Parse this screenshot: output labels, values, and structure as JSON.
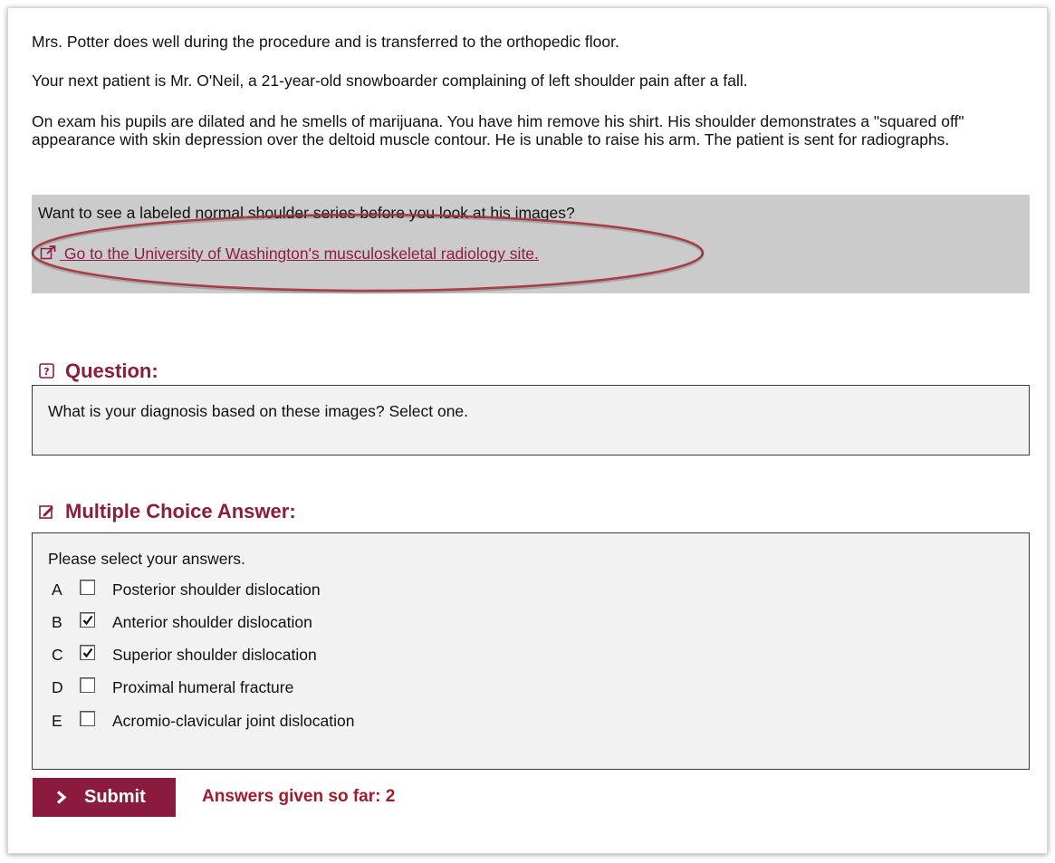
{
  "case_text": {
    "p1": "Mrs. Potter does well during the procedure and is transferred to the orthopedic floor.",
    "p2": "Your next patient is Mr. O'Neil, a 21-year-old snowboarder complaining of left shoulder pain after a fall.",
    "p3": "On exam his pupils are dilated and he smells of marijuana. You have him remove his shirt. His shoulder demonstrates a \"squared off\" appearance with skin depression over the deltoid muscle contour. He is unable to raise his arm. The patient is sent for radiographs."
  },
  "resource_box": {
    "prompt": "Want to see a labeled normal shoulder series before you look at his images?",
    "link_text": " Go to the University of Washington's musculoskeletal radiology site.",
    "link_icon": "external-link-icon",
    "highlight_color": "#b0303a"
  },
  "question": {
    "title": "Question:",
    "icon": "question-icon",
    "text": "What is your diagnosis based on these images? Select one."
  },
  "multiple_choice": {
    "title": "Multiple Choice Answer:",
    "icon": "edit-icon",
    "prompt": "Please select your answers.",
    "choices": [
      {
        "letter": "A",
        "text": "Posterior shoulder dislocation",
        "checked": false
      },
      {
        "letter": "B",
        "text": "Anterior shoulder dislocation",
        "checked": true
      },
      {
        "letter": "C",
        "text": "Superior shoulder dislocation",
        "checked": true
      },
      {
        "letter": "D",
        "text": "Proximal humeral fracture",
        "checked": false
      },
      {
        "letter": "E",
        "text": "Acromio-clavicular joint dislocation",
        "checked": false
      }
    ]
  },
  "footer": {
    "submit_label": "Submit",
    "answers_count": "Answers given so far: 2"
  },
  "colors": {
    "accent": "#8b1a3f",
    "answers_text": "#a01c2c",
    "gray_box": "#cbcbcb",
    "panel_bg": "#f2f2f2"
  }
}
